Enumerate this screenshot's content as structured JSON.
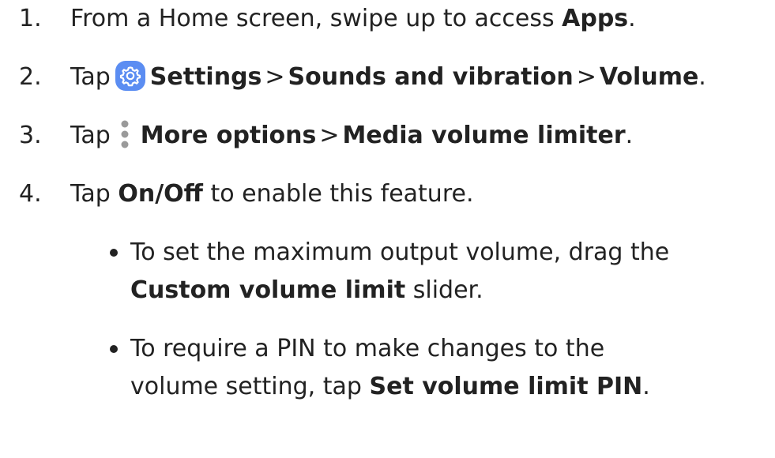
{
  "steps": [
    {
      "number": "1.",
      "text_before": "From a Home screen, swipe up to access ",
      "bold_apps": "Apps",
      "end": "."
    },
    {
      "number": "2.",
      "tap": "Tap",
      "icon": "gear-icon",
      "settings": "Settings",
      "separator": ">",
      "sounds": "Sounds and vibration",
      "volume": "Volume",
      "end": "."
    },
    {
      "number": "3.",
      "tap": "Tap",
      "icon": "more-options-icon",
      "more_options": "More options",
      "separator": ">",
      "limiter": "Media volume limiter",
      "end": "."
    },
    {
      "number": "4.",
      "tap": "Tap ",
      "onoff": "On/Off",
      "after": " to enable this feature."
    }
  ],
  "bullets": [
    {
      "line1": "To set the maximum output volume, drag the",
      "line2_bold": "Custom volume limit",
      "line2_after": " slider."
    },
    {
      "line1": "To require a PIN to make changes to the",
      "line2_before": "volume setting, tap ",
      "line2_bold": "Set volume limit PIN",
      "line2_end": "."
    }
  ],
  "colors": {
    "text": "#222222",
    "gear_icon_bg": "#5b8df2",
    "more_icon": "#9a9a9a"
  }
}
